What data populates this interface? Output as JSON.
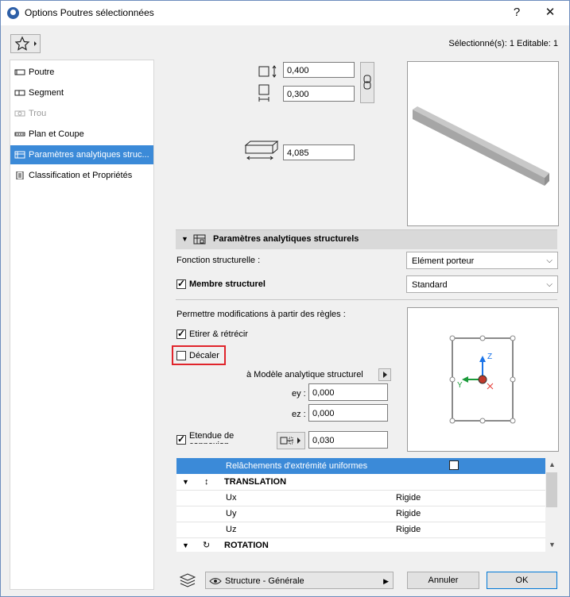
{
  "window": {
    "title": "Options Poutres sélectionnées",
    "help_label": "?",
    "close_label": "✕"
  },
  "header": {
    "selection_info": "Sélectionné(s): 1 Editable: 1"
  },
  "sidebar": {
    "items": [
      {
        "label": "Poutre"
      },
      {
        "label": "Segment"
      },
      {
        "label": "Trou"
      },
      {
        "label": "Plan et Coupe"
      },
      {
        "label": "Paramètres analytiques struc..."
      },
      {
        "label": "Classification et Propriétés"
      }
    ]
  },
  "geometry": {
    "height": "0,400",
    "width": "0,300",
    "length": "4,085"
  },
  "section": {
    "title": "Paramètres analytiques structurels"
  },
  "structural": {
    "function_label": "Fonction structurelle :",
    "function_value": "Elément porteur",
    "member_label": "Membre structurel",
    "member_value": "Standard",
    "rules_label": "Permettre modifications à partir des règles :",
    "stretch_label": "Etirer & rétrécir",
    "offset_label": "Décaler",
    "model_link_label": "à Modèle analytique structurel",
    "ey_label": "ey :",
    "ey_value": "0,000",
    "ez_label": "ez :",
    "ez_value": "0,000",
    "connection_label_1": "Etendue de",
    "connection_label_2": "connexion",
    "connection_value": "0,030"
  },
  "axes": {
    "z": "Z",
    "y": "Y"
  },
  "table": {
    "header": "Relâchements d'extrémité uniformes",
    "groups": [
      {
        "title": "TRANSLATION",
        "rows": [
          {
            "axis": "Ux",
            "value": "Rigide"
          },
          {
            "axis": "Uy",
            "value": "Rigide"
          },
          {
            "axis": "Uz",
            "value": "Rigide"
          }
        ]
      },
      {
        "title": "ROTATION"
      }
    ]
  },
  "footer": {
    "favorite_label": "Structure - Générale",
    "cancel_label": "Annuler",
    "ok_label": "OK"
  },
  "colors": {
    "accent": "#3b8ad8",
    "highlight_box": "#e0242b"
  }
}
